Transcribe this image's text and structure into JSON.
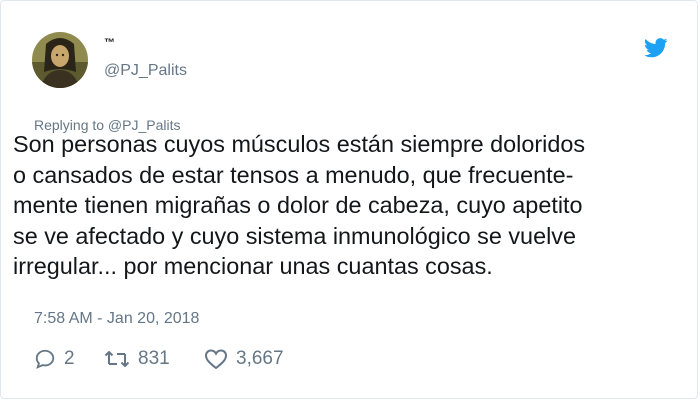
{
  "user": {
    "display_name": "™",
    "handle": "@PJ_Palits",
    "avatar_icon": "avatar-portrait",
    "brand_icon": "twitter-bird-icon"
  },
  "tweet": {
    "replying_to": "Replying to @PJ_Palits",
    "text": "Son personas cuyos músculos están siempre doloridos\no cansados de estar tensos a menudo, que frecuente-\nmente tienen migrañas o dolor de cabeza, cuyo apetito\nse ve afectado y cuyo sistema inmunológico se vuelve\nirregular... por mencionar unas cuantas cosas.",
    "timestamp": "7:58 AM - Jan 20, 2018"
  },
  "actions": {
    "replies": "2",
    "retweets": "831",
    "likes": "3,667"
  },
  "colors": {
    "text": "#14171a",
    "secondary": "#657786",
    "brand": "#1da1f2",
    "border": "#e1e8ed"
  }
}
